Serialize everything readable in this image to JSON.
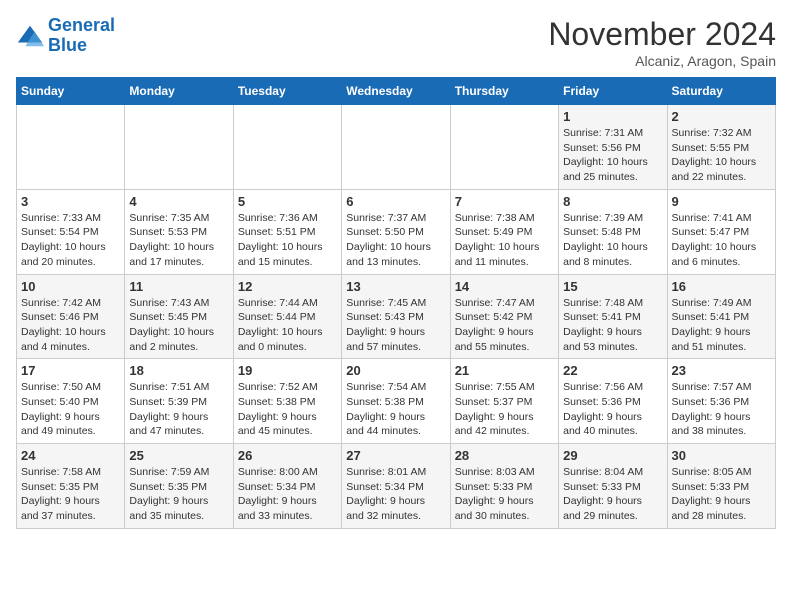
{
  "logo": {
    "line1": "General",
    "line2": "Blue"
  },
  "title": "November 2024",
  "location": "Alcaniz, Aragon, Spain",
  "weekdays": [
    "Sunday",
    "Monday",
    "Tuesday",
    "Wednesday",
    "Thursday",
    "Friday",
    "Saturday"
  ],
  "weeks": [
    [
      {
        "day": "",
        "info": ""
      },
      {
        "day": "",
        "info": ""
      },
      {
        "day": "",
        "info": ""
      },
      {
        "day": "",
        "info": ""
      },
      {
        "day": "",
        "info": ""
      },
      {
        "day": "1",
        "info": "Sunrise: 7:31 AM\nSunset: 5:56 PM\nDaylight: 10 hours\nand 25 minutes."
      },
      {
        "day": "2",
        "info": "Sunrise: 7:32 AM\nSunset: 5:55 PM\nDaylight: 10 hours\nand 22 minutes."
      }
    ],
    [
      {
        "day": "3",
        "info": "Sunrise: 7:33 AM\nSunset: 5:54 PM\nDaylight: 10 hours\nand 20 minutes."
      },
      {
        "day": "4",
        "info": "Sunrise: 7:35 AM\nSunset: 5:53 PM\nDaylight: 10 hours\nand 17 minutes."
      },
      {
        "day": "5",
        "info": "Sunrise: 7:36 AM\nSunset: 5:51 PM\nDaylight: 10 hours\nand 15 minutes."
      },
      {
        "day": "6",
        "info": "Sunrise: 7:37 AM\nSunset: 5:50 PM\nDaylight: 10 hours\nand 13 minutes."
      },
      {
        "day": "7",
        "info": "Sunrise: 7:38 AM\nSunset: 5:49 PM\nDaylight: 10 hours\nand 11 minutes."
      },
      {
        "day": "8",
        "info": "Sunrise: 7:39 AM\nSunset: 5:48 PM\nDaylight: 10 hours\nand 8 minutes."
      },
      {
        "day": "9",
        "info": "Sunrise: 7:41 AM\nSunset: 5:47 PM\nDaylight: 10 hours\nand 6 minutes."
      }
    ],
    [
      {
        "day": "10",
        "info": "Sunrise: 7:42 AM\nSunset: 5:46 PM\nDaylight: 10 hours\nand 4 minutes."
      },
      {
        "day": "11",
        "info": "Sunrise: 7:43 AM\nSunset: 5:45 PM\nDaylight: 10 hours\nand 2 minutes."
      },
      {
        "day": "12",
        "info": "Sunrise: 7:44 AM\nSunset: 5:44 PM\nDaylight: 10 hours\nand 0 minutes."
      },
      {
        "day": "13",
        "info": "Sunrise: 7:45 AM\nSunset: 5:43 PM\nDaylight: 9 hours\nand 57 minutes."
      },
      {
        "day": "14",
        "info": "Sunrise: 7:47 AM\nSunset: 5:42 PM\nDaylight: 9 hours\nand 55 minutes."
      },
      {
        "day": "15",
        "info": "Sunrise: 7:48 AM\nSunset: 5:41 PM\nDaylight: 9 hours\nand 53 minutes."
      },
      {
        "day": "16",
        "info": "Sunrise: 7:49 AM\nSunset: 5:41 PM\nDaylight: 9 hours\nand 51 minutes."
      }
    ],
    [
      {
        "day": "17",
        "info": "Sunrise: 7:50 AM\nSunset: 5:40 PM\nDaylight: 9 hours\nand 49 minutes."
      },
      {
        "day": "18",
        "info": "Sunrise: 7:51 AM\nSunset: 5:39 PM\nDaylight: 9 hours\nand 47 minutes."
      },
      {
        "day": "19",
        "info": "Sunrise: 7:52 AM\nSunset: 5:38 PM\nDaylight: 9 hours\nand 45 minutes."
      },
      {
        "day": "20",
        "info": "Sunrise: 7:54 AM\nSunset: 5:38 PM\nDaylight: 9 hours\nand 44 minutes."
      },
      {
        "day": "21",
        "info": "Sunrise: 7:55 AM\nSunset: 5:37 PM\nDaylight: 9 hours\nand 42 minutes."
      },
      {
        "day": "22",
        "info": "Sunrise: 7:56 AM\nSunset: 5:36 PM\nDaylight: 9 hours\nand 40 minutes."
      },
      {
        "day": "23",
        "info": "Sunrise: 7:57 AM\nSunset: 5:36 PM\nDaylight: 9 hours\nand 38 minutes."
      }
    ],
    [
      {
        "day": "24",
        "info": "Sunrise: 7:58 AM\nSunset: 5:35 PM\nDaylight: 9 hours\nand 37 minutes."
      },
      {
        "day": "25",
        "info": "Sunrise: 7:59 AM\nSunset: 5:35 PM\nDaylight: 9 hours\nand 35 minutes."
      },
      {
        "day": "26",
        "info": "Sunrise: 8:00 AM\nSunset: 5:34 PM\nDaylight: 9 hours\nand 33 minutes."
      },
      {
        "day": "27",
        "info": "Sunrise: 8:01 AM\nSunset: 5:34 PM\nDaylight: 9 hours\nand 32 minutes."
      },
      {
        "day": "28",
        "info": "Sunrise: 8:03 AM\nSunset: 5:33 PM\nDaylight: 9 hours\nand 30 minutes."
      },
      {
        "day": "29",
        "info": "Sunrise: 8:04 AM\nSunset: 5:33 PM\nDaylight: 9 hours\nand 29 minutes."
      },
      {
        "day": "30",
        "info": "Sunrise: 8:05 AM\nSunset: 5:33 PM\nDaylight: 9 hours\nand 28 minutes."
      }
    ]
  ]
}
